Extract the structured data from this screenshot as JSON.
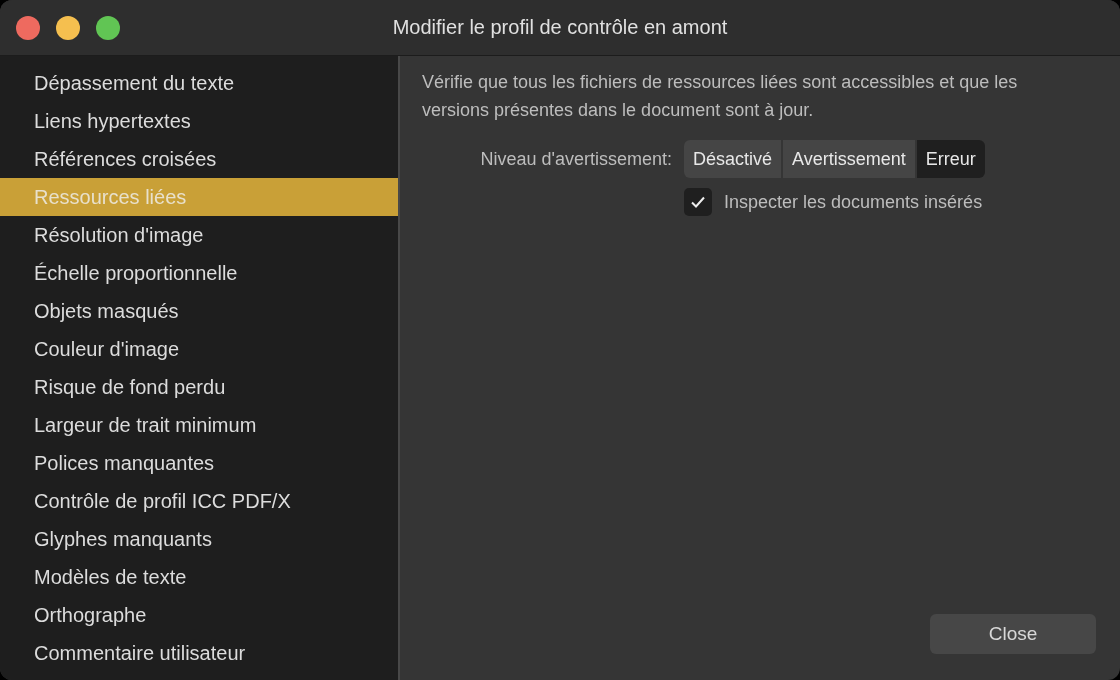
{
  "window": {
    "title": "Modifier le profil de contrôle en amont"
  },
  "sidebar": {
    "items": [
      {
        "label": "Dépassement du texte",
        "selected": false
      },
      {
        "label": "Liens hypertextes",
        "selected": false
      },
      {
        "label": "Références croisées",
        "selected": false
      },
      {
        "label": "Ressources liées",
        "selected": true
      },
      {
        "label": "Résolution d'image",
        "selected": false
      },
      {
        "label": "Échelle proportionnelle",
        "selected": false
      },
      {
        "label": "Objets masqués",
        "selected": false
      },
      {
        "label": "Couleur d'image",
        "selected": false
      },
      {
        "label": "Risque de fond perdu",
        "selected": false
      },
      {
        "label": "Largeur de trait minimum",
        "selected": false
      },
      {
        "label": "Polices manquantes",
        "selected": false
      },
      {
        "label": "Contrôle de profil ICC PDF/X",
        "selected": false
      },
      {
        "label": "Glyphes manquants",
        "selected": false
      },
      {
        "label": "Modèles de texte",
        "selected": false
      },
      {
        "label": "Orthographe",
        "selected": false
      },
      {
        "label": "Commentaire utilisateur",
        "selected": false
      }
    ]
  },
  "description": "Vérifie que tous les fichiers de ressources liées sont accessibles et que les versions présentes dans le document sont à jour.",
  "warning_level": {
    "label": "Niveau d'avertissement:",
    "options": [
      {
        "label": "Désactivé",
        "selected": false
      },
      {
        "label": "Avertissement",
        "selected": false
      },
      {
        "label": "Erreur",
        "selected": true
      }
    ]
  },
  "checkbox": {
    "label": "Inspecter les documents insérés",
    "checked": true
  },
  "buttons": [
    "Close"
  ]
}
